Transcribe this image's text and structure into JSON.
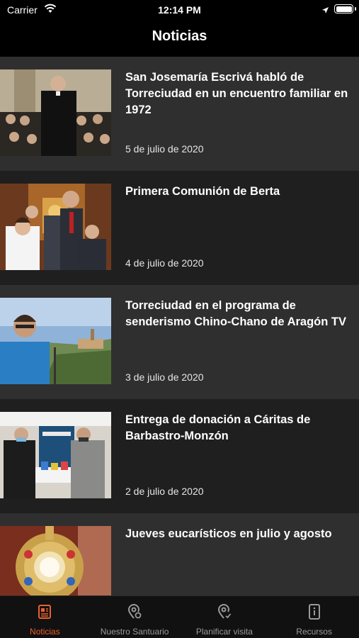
{
  "status_bar": {
    "carrier": "Carrier",
    "time": "12:14 PM"
  },
  "nav": {
    "title": "Noticias"
  },
  "news": [
    {
      "title": "San Josemaría Escrivá habló de Torreciudad en un encuentro familiar en 1972",
      "date": "5 de julio de 2020"
    },
    {
      "title": "Primera Comunión de Berta",
      "date": "4 de julio de 2020"
    },
    {
      "title": "Torreciudad en el programa de senderismo Chino-Chano de Aragón TV",
      "date": "3 de julio de 2020"
    },
    {
      "title": "Entrega de donación a Cáritas de Barbastro-Monzón",
      "date": "2 de julio de 2020"
    },
    {
      "title": "Jueves eucarísticos en julio y agosto",
      "date": ""
    }
  ],
  "tabs": [
    {
      "label": "Noticias",
      "icon": "newspaper-icon",
      "active": true
    },
    {
      "label": "Nuestro Santuario",
      "icon": "location-pin-icon",
      "active": false
    },
    {
      "label": "Planificar visita",
      "icon": "map-pin-icon",
      "active": false
    },
    {
      "label": "Recursos",
      "icon": "info-book-icon",
      "active": false
    }
  ],
  "colors": {
    "accent": "#e8612c",
    "row_light": "#2f2f2f",
    "row_dark": "#1f1f1f"
  }
}
